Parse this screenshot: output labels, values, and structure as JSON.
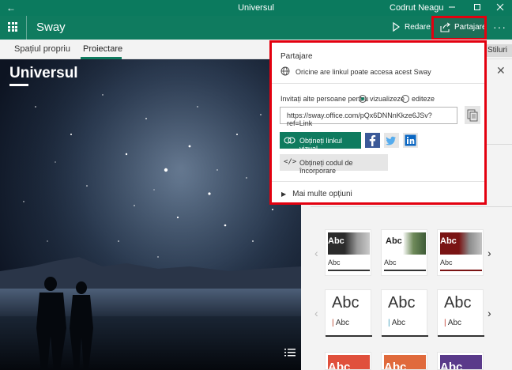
{
  "window": {
    "title": "Universul",
    "user": "Codrut Neagu",
    "back_glyph": "←",
    "controls": [
      "minimize-icon",
      "maximize-icon",
      "close-icon"
    ]
  },
  "appbar": {
    "brand": "Sway",
    "play_label": "Redare",
    "share_label": "Partajare",
    "more_glyph": "···",
    "accent": "#0f7b5f"
  },
  "nav": {
    "tabs": [
      "Spațiul propriu",
      "Proiectare"
    ],
    "active_tab": "Proiectare",
    "styles_tab": "Stiluri"
  },
  "content": {
    "title": "Universul"
  },
  "share_popup": {
    "header": "Partajare",
    "access_text": "Oricine are linkul poate accesa acest Sway",
    "invite_label": "Invitați alte persoane pentru",
    "option_view": "vizualizeze",
    "option_edit": "editeze",
    "selected_option": "vizualizeze",
    "link_value": "https://sway.office.com/pQx6DNNnKkze6JSv?ref=Link",
    "visual_link_button": "Obțineți linkul vizual",
    "embed_button": "Obțineți codul de încorporare",
    "more_options": "Mai multe opțiuni",
    "social_icons": [
      "facebook-icon",
      "twitter-icon",
      "linkedin-icon"
    ],
    "highlight_color": "#e3000f"
  },
  "style_cards": {
    "row1": [
      {
        "label": "Abc",
        "small": "Abc",
        "accent": "#555555"
      },
      {
        "label": "Abc",
        "small": "Abc",
        "accent": "#222222"
      },
      {
        "label": "Abc",
        "small": "Abc",
        "accent": "#8b1a1a"
      }
    ],
    "row2": [
      {
        "label": "Abc",
        "small": "Abc",
        "accent": "#b8412a"
      },
      {
        "label": "Abc",
        "small": "Abc",
        "accent": "#3a9ab8"
      },
      {
        "label": "Abc",
        "small": "Abc",
        "accent": "#c23b2e"
      }
    ],
    "row3": [
      {
        "label": "Abc",
        "accent": "#e0503c"
      },
      {
        "label": "Abc",
        "accent": "#e06a3c"
      },
      {
        "label": "Abc",
        "accent": "#5a3a8a"
      }
    ]
  }
}
